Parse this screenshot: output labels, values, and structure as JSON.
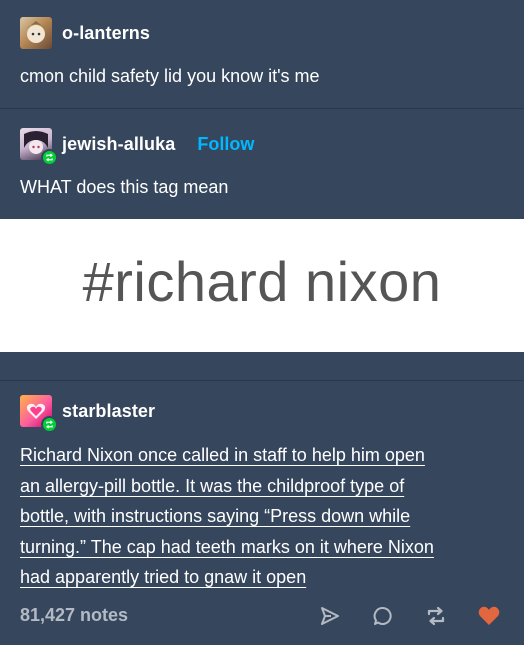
{
  "posts": [
    {
      "username": "o-lanterns",
      "text": "cmon child safety lid you know it's me"
    },
    {
      "username": "jewish-alluka",
      "follow_label": "Follow",
      "text": "WHAT does this tag mean",
      "image_text": "#richard nixon"
    },
    {
      "username": "starblaster",
      "text_lines": [
        "Richard Nixon once called in staff to help him open",
        "an allergy-pill bottle. It was the childproof type of",
        "bottle, with instructions saying “Press down while",
        "turning.” The cap had teeth marks on it where Nixon",
        "had apparently tried to gnaw it open"
      ]
    }
  ],
  "footer": {
    "notes": "81,427 notes"
  },
  "icons": {
    "share": "share-icon",
    "reply": "reply-icon",
    "reblog": "reblog-icon",
    "like": "heart-icon"
  },
  "colors": {
    "background": "#36465d",
    "follow": "#00b8ff",
    "reblog_badge": "#00cf35",
    "like": "#e2673f"
  }
}
